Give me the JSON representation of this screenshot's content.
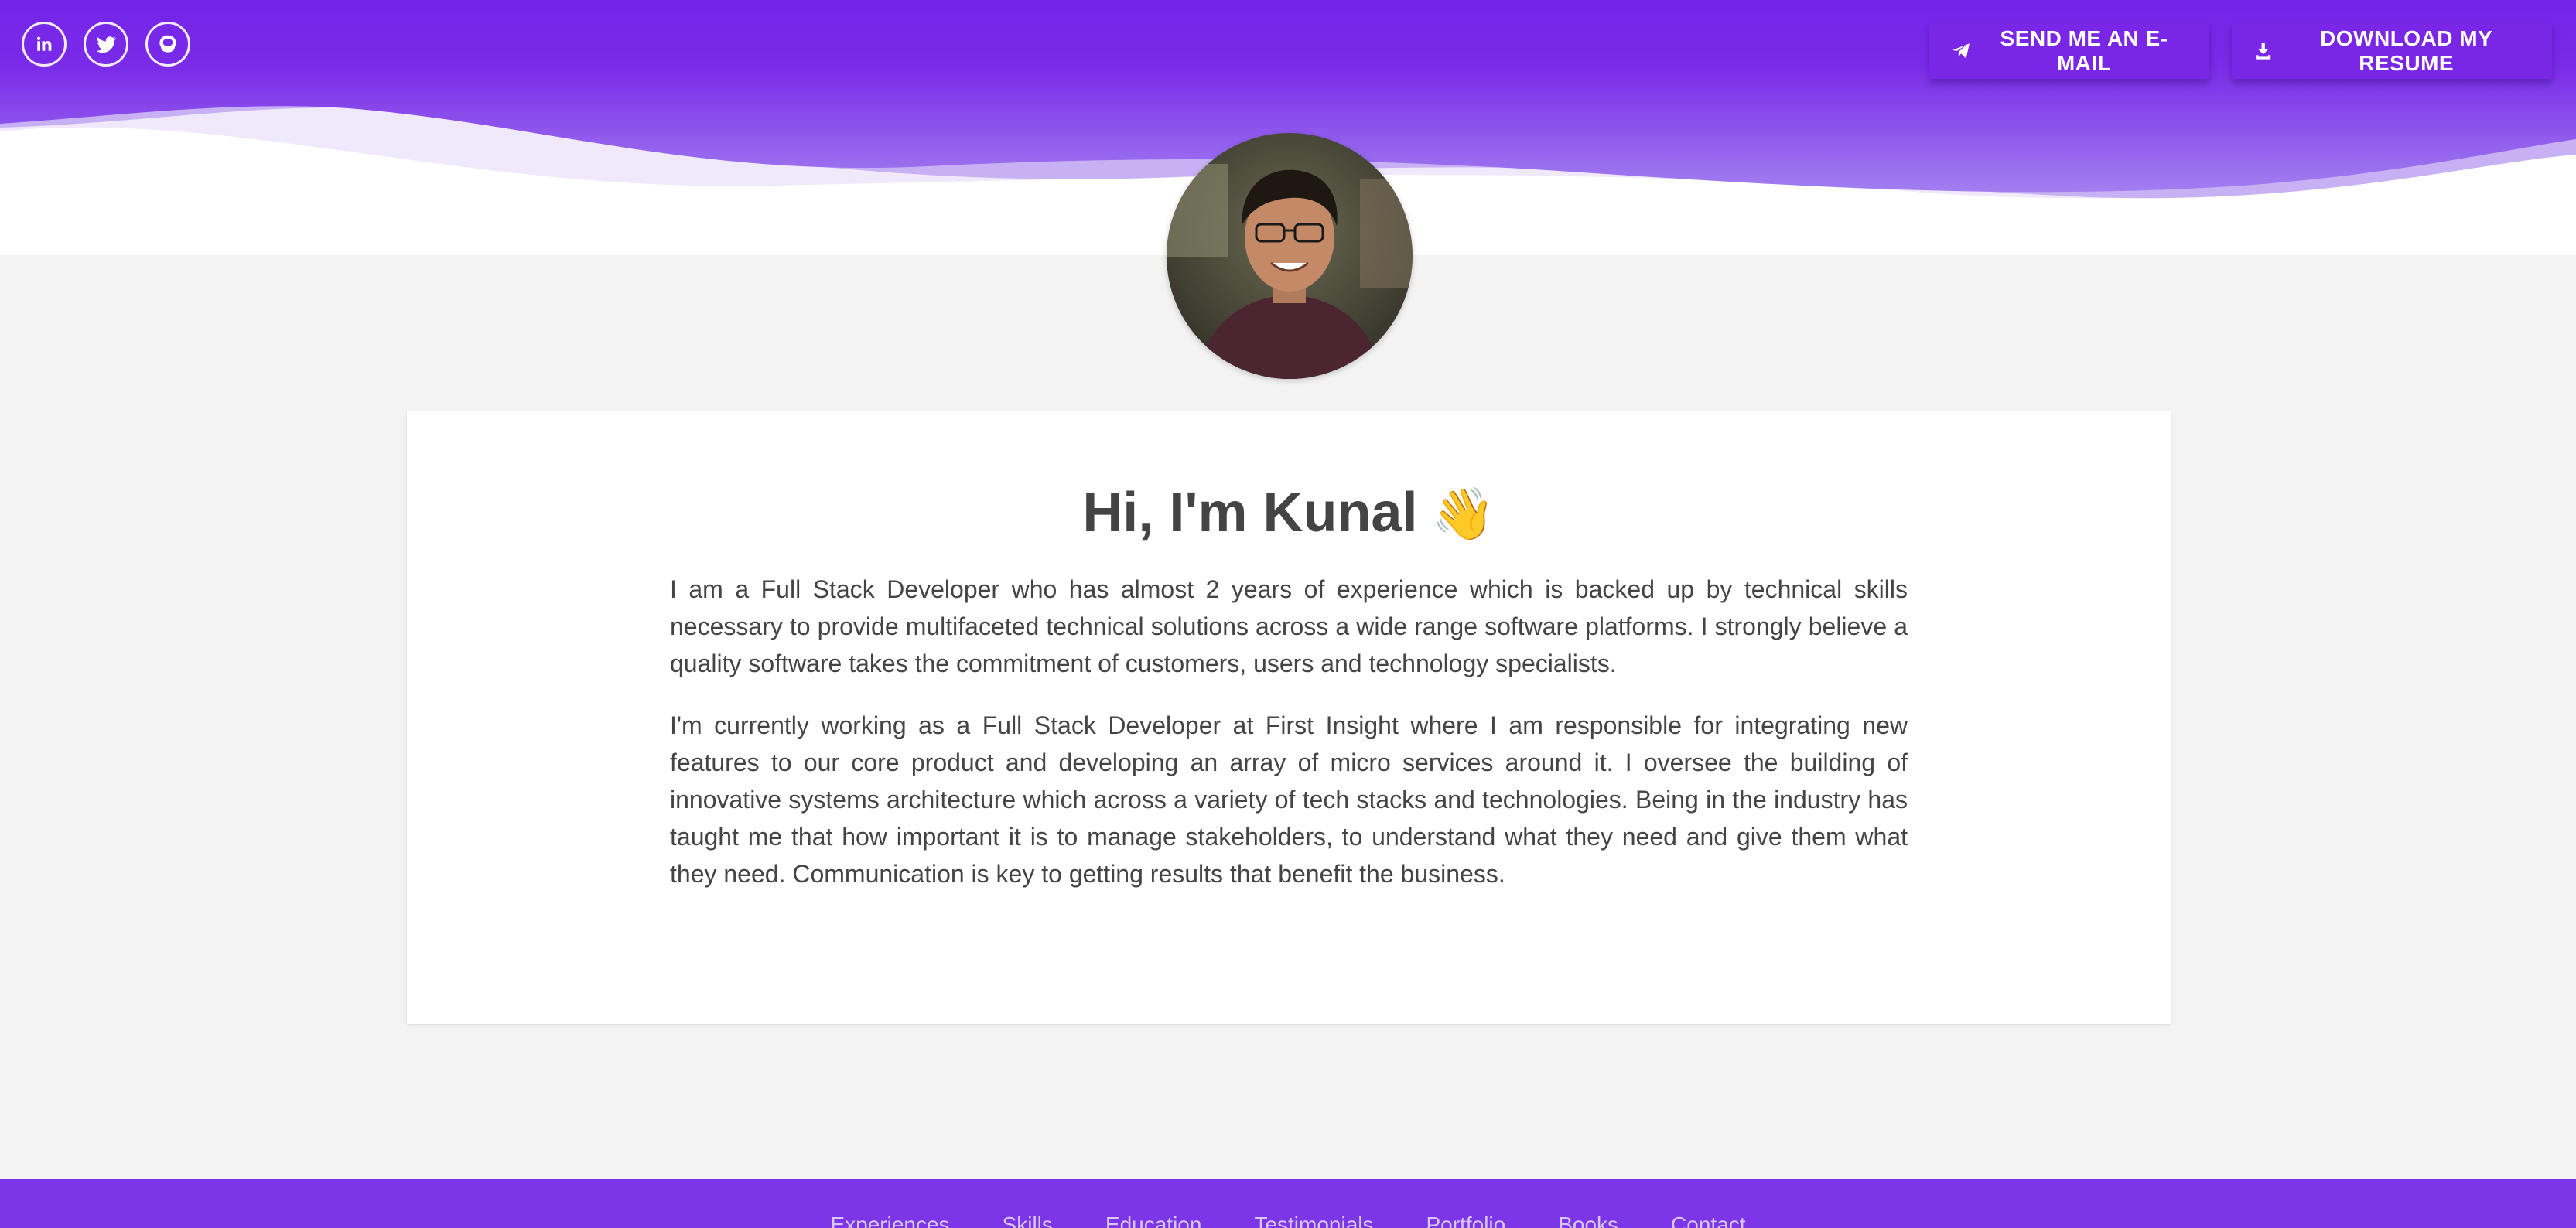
{
  "header": {
    "social": [
      {
        "name": "linkedin-icon"
      },
      {
        "name": "twitter-icon"
      },
      {
        "name": "github-icon"
      }
    ],
    "email_button_label": "SEND ME AN E-MAIL",
    "resume_button_label": "DOWNLOAD MY RESUME",
    "accent_color": "#7a26e6"
  },
  "profile": {
    "avatar": "avatar-photo"
  },
  "intro": {
    "title": "Hi, I'm Kunal",
    "emoji": "👋",
    "paragraphs": [
      "I am a Full Stack Developer who has almost 2 years of experience which is backed up by technical skills necessary to provide multifaceted technical solutions across a wide range software platforms. I strongly believe a quality software takes the commitment of customers, users and technology specialists.",
      "I'm currently working as a Full Stack Developer at First Insight where I am responsible for integrating new features to our core product and developing an array of micro services around it. I oversee the building of innovative systems architecture which across a variety of tech stacks and technologies. Being in the industry has taught me that how important it is to manage stakeholders, to understand what they need and give them what they need. Communication is key to getting results that benefit the business."
    ]
  },
  "footer": {
    "links": [
      "Experiences",
      "Skills",
      "Education",
      "Testimonials",
      "Portfolio",
      "Books",
      "Contact"
    ],
    "color": "#7c36e8"
  }
}
